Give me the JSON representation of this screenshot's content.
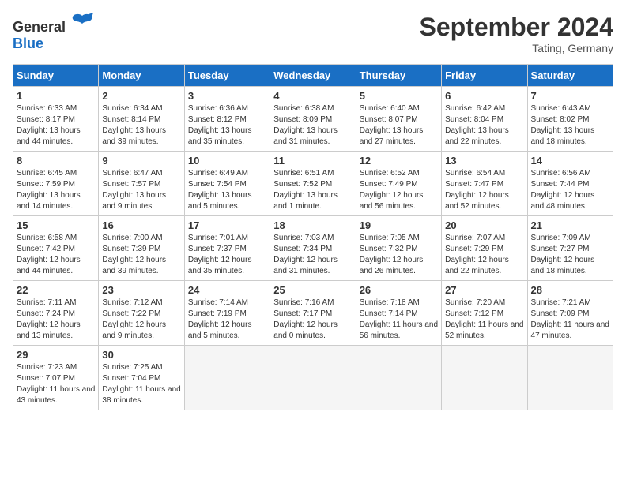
{
  "header": {
    "logo_general": "General",
    "logo_blue": "Blue",
    "month_title": "September 2024",
    "location": "Tating, Germany"
  },
  "days_of_week": [
    "Sunday",
    "Monday",
    "Tuesday",
    "Wednesday",
    "Thursday",
    "Friday",
    "Saturday"
  ],
  "weeks": [
    [
      {
        "day": "1",
        "sunrise": "6:33 AM",
        "sunset": "8:17 PM",
        "daylight": "13 hours and 44 minutes."
      },
      {
        "day": "2",
        "sunrise": "6:34 AM",
        "sunset": "8:14 PM",
        "daylight": "13 hours and 39 minutes."
      },
      {
        "day": "3",
        "sunrise": "6:36 AM",
        "sunset": "8:12 PM",
        "daylight": "13 hours and 35 minutes."
      },
      {
        "day": "4",
        "sunrise": "6:38 AM",
        "sunset": "8:09 PM",
        "daylight": "13 hours and 31 minutes."
      },
      {
        "day": "5",
        "sunrise": "6:40 AM",
        "sunset": "8:07 PM",
        "daylight": "13 hours and 27 minutes."
      },
      {
        "day": "6",
        "sunrise": "6:42 AM",
        "sunset": "8:04 PM",
        "daylight": "13 hours and 22 minutes."
      },
      {
        "day": "7",
        "sunrise": "6:43 AM",
        "sunset": "8:02 PM",
        "daylight": "13 hours and 18 minutes."
      }
    ],
    [
      {
        "day": "8",
        "sunrise": "6:45 AM",
        "sunset": "7:59 PM",
        "daylight": "13 hours and 14 minutes."
      },
      {
        "day": "9",
        "sunrise": "6:47 AM",
        "sunset": "7:57 PM",
        "daylight": "13 hours and 9 minutes."
      },
      {
        "day": "10",
        "sunrise": "6:49 AM",
        "sunset": "7:54 PM",
        "daylight": "13 hours and 5 minutes."
      },
      {
        "day": "11",
        "sunrise": "6:51 AM",
        "sunset": "7:52 PM",
        "daylight": "13 hours and 1 minute."
      },
      {
        "day": "12",
        "sunrise": "6:52 AM",
        "sunset": "7:49 PM",
        "daylight": "12 hours and 56 minutes."
      },
      {
        "day": "13",
        "sunrise": "6:54 AM",
        "sunset": "7:47 PM",
        "daylight": "12 hours and 52 minutes."
      },
      {
        "day": "14",
        "sunrise": "6:56 AM",
        "sunset": "7:44 PM",
        "daylight": "12 hours and 48 minutes."
      }
    ],
    [
      {
        "day": "15",
        "sunrise": "6:58 AM",
        "sunset": "7:42 PM",
        "daylight": "12 hours and 44 minutes."
      },
      {
        "day": "16",
        "sunrise": "7:00 AM",
        "sunset": "7:39 PM",
        "daylight": "12 hours and 39 minutes."
      },
      {
        "day": "17",
        "sunrise": "7:01 AM",
        "sunset": "7:37 PM",
        "daylight": "12 hours and 35 minutes."
      },
      {
        "day": "18",
        "sunrise": "7:03 AM",
        "sunset": "7:34 PM",
        "daylight": "12 hours and 31 minutes."
      },
      {
        "day": "19",
        "sunrise": "7:05 AM",
        "sunset": "7:32 PM",
        "daylight": "12 hours and 26 minutes."
      },
      {
        "day": "20",
        "sunrise": "7:07 AM",
        "sunset": "7:29 PM",
        "daylight": "12 hours and 22 minutes."
      },
      {
        "day": "21",
        "sunrise": "7:09 AM",
        "sunset": "7:27 PM",
        "daylight": "12 hours and 18 minutes."
      }
    ],
    [
      {
        "day": "22",
        "sunrise": "7:11 AM",
        "sunset": "7:24 PM",
        "daylight": "12 hours and 13 minutes."
      },
      {
        "day": "23",
        "sunrise": "7:12 AM",
        "sunset": "7:22 PM",
        "daylight": "12 hours and 9 minutes."
      },
      {
        "day": "24",
        "sunrise": "7:14 AM",
        "sunset": "7:19 PM",
        "daylight": "12 hours and 5 minutes."
      },
      {
        "day": "25",
        "sunrise": "7:16 AM",
        "sunset": "7:17 PM",
        "daylight": "12 hours and 0 minutes."
      },
      {
        "day": "26",
        "sunrise": "7:18 AM",
        "sunset": "7:14 PM",
        "daylight": "11 hours and 56 minutes."
      },
      {
        "day": "27",
        "sunrise": "7:20 AM",
        "sunset": "7:12 PM",
        "daylight": "11 hours and 52 minutes."
      },
      {
        "day": "28",
        "sunrise": "7:21 AM",
        "sunset": "7:09 PM",
        "daylight": "11 hours and 47 minutes."
      }
    ],
    [
      {
        "day": "29",
        "sunrise": "7:23 AM",
        "sunset": "7:07 PM",
        "daylight": "11 hours and 43 minutes."
      },
      {
        "day": "30",
        "sunrise": "7:25 AM",
        "sunset": "7:04 PM",
        "daylight": "11 hours and 38 minutes."
      },
      null,
      null,
      null,
      null,
      null
    ]
  ]
}
